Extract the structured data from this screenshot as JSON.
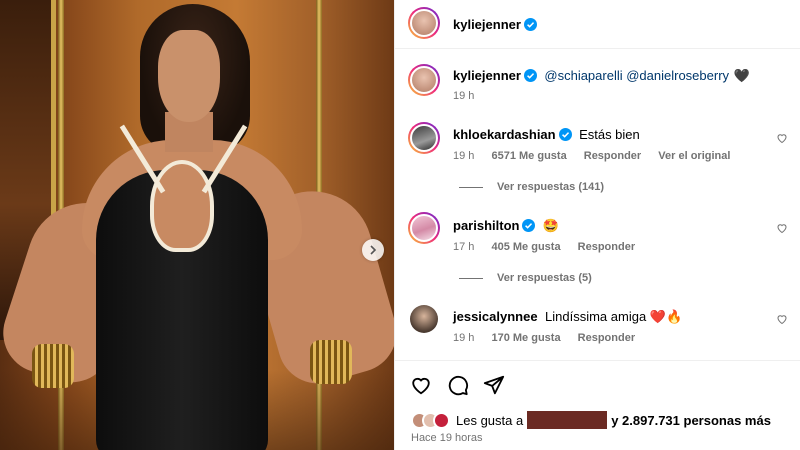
{
  "header": {
    "username": "kyliejenner"
  },
  "caption": {
    "username": "kyliejenner",
    "mentions": "@schiaparelli @danielroseberry",
    "emoji": "🖤",
    "time": "19 h"
  },
  "comments": [
    {
      "username": "khloekardashian",
      "verified": true,
      "text": "Estás bien",
      "time": "19 h",
      "likes": "6571 Me gusta",
      "reply": "Responder",
      "extra": "Ver el original",
      "view_replies": "Ver respuestas (141)"
    },
    {
      "username": "parishilton",
      "verified": true,
      "text": "🤩",
      "time": "17 h",
      "likes": "405 Me gusta",
      "reply": "Responder",
      "view_replies": "Ver respuestas (5)"
    },
    {
      "username": "jessicalynnee",
      "verified": false,
      "text": "Lindíssima amiga ❤️🔥",
      "time": "19 h",
      "likes": "170 Me gusta",
      "reply": "Responder"
    }
  ],
  "likes_bar": {
    "prefix": "Les gusta a",
    "suffix": "y 2.897.731 personas más",
    "time_ago": "Hace 19 horas"
  },
  "colors": {
    "verified": "#0095f6",
    "meta": "#737373",
    "redaction": "#6b2a23"
  }
}
